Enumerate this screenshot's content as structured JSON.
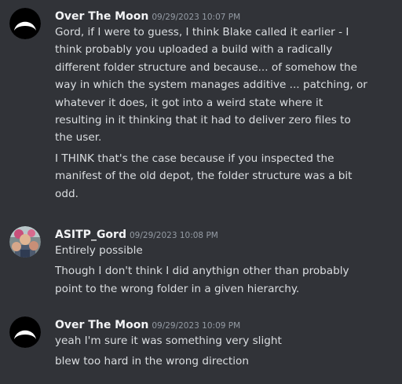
{
  "messages": [
    {
      "author": "Over The Moon",
      "avatar": "crescent-moon-avatar",
      "timestamp": "09/29/2023 10:07 PM",
      "lines": [
        "Gord, if I were to guess, I think Blake called it earlier - I\nthink probably you uploaded a build with a radically\ndifferent folder structure and because... of somehow the\nway in which the system manages additive ... patching, or\nwhatever it does, it got into a weird state where it\nresulting in it thinking that it had to deliver zero files to\nthe user.",
        "I THINK that's the case because if you inspected the\nmanifest of the old depot, the folder structure was a bit\nodd."
      ]
    },
    {
      "author": "ASITP_Gord",
      "avatar": "photo-avatar",
      "timestamp": "09/29/2023 10:08 PM",
      "lines": [
        "Entirely possible",
        "Though I don't think I did anythign other than probably\npoint to the wrong folder in a given hierarchy."
      ]
    },
    {
      "author": "Over The Moon",
      "avatar": "crescent-moon-avatar",
      "timestamp": "09/29/2023 10:09 PM",
      "lines": [
        "yeah I'm sure it was something very slight",
        "blew too hard in the wrong direction"
      ]
    }
  ]
}
